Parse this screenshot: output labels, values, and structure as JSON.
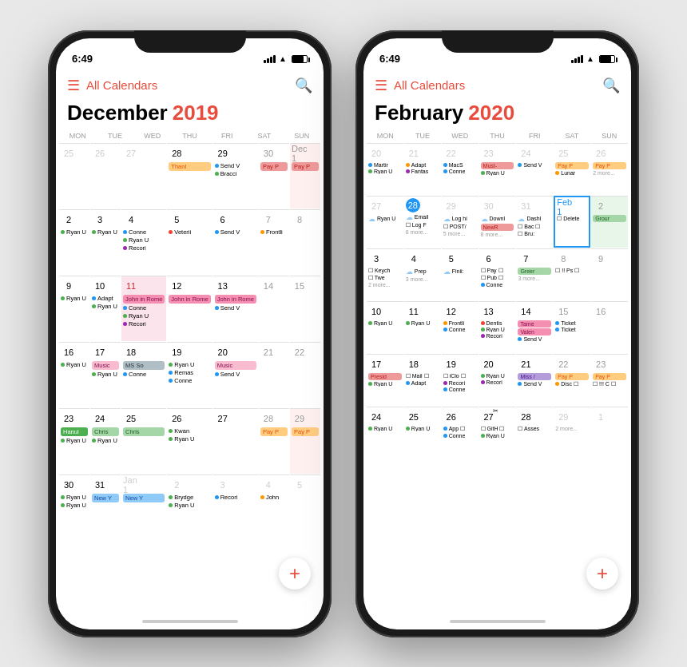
{
  "phone1": {
    "statusBar": {
      "time": "6:49",
      "signal": true,
      "wifi": true,
      "battery": true
    },
    "header": {
      "logo": "📅",
      "title": "All Calendars",
      "search": "🔍"
    },
    "monthName": "December",
    "year": "2019",
    "dayHeaders": [
      "MON",
      "TUE",
      "WED",
      "THU",
      "FRI",
      "SAT",
      "SUN"
    ],
    "fab": "+"
  },
  "phone2": {
    "statusBar": {
      "time": "6:49",
      "signal": true,
      "wifi": true,
      "battery": true
    },
    "header": {
      "logo": "📅",
      "title": "All Calendars",
      "search": "🔍"
    },
    "monthName": "February",
    "year": "2020",
    "dayHeaders": [
      "MON",
      "TUE",
      "WED",
      "THU",
      "FRI",
      "SAT",
      "SUN"
    ],
    "fab": "+"
  }
}
